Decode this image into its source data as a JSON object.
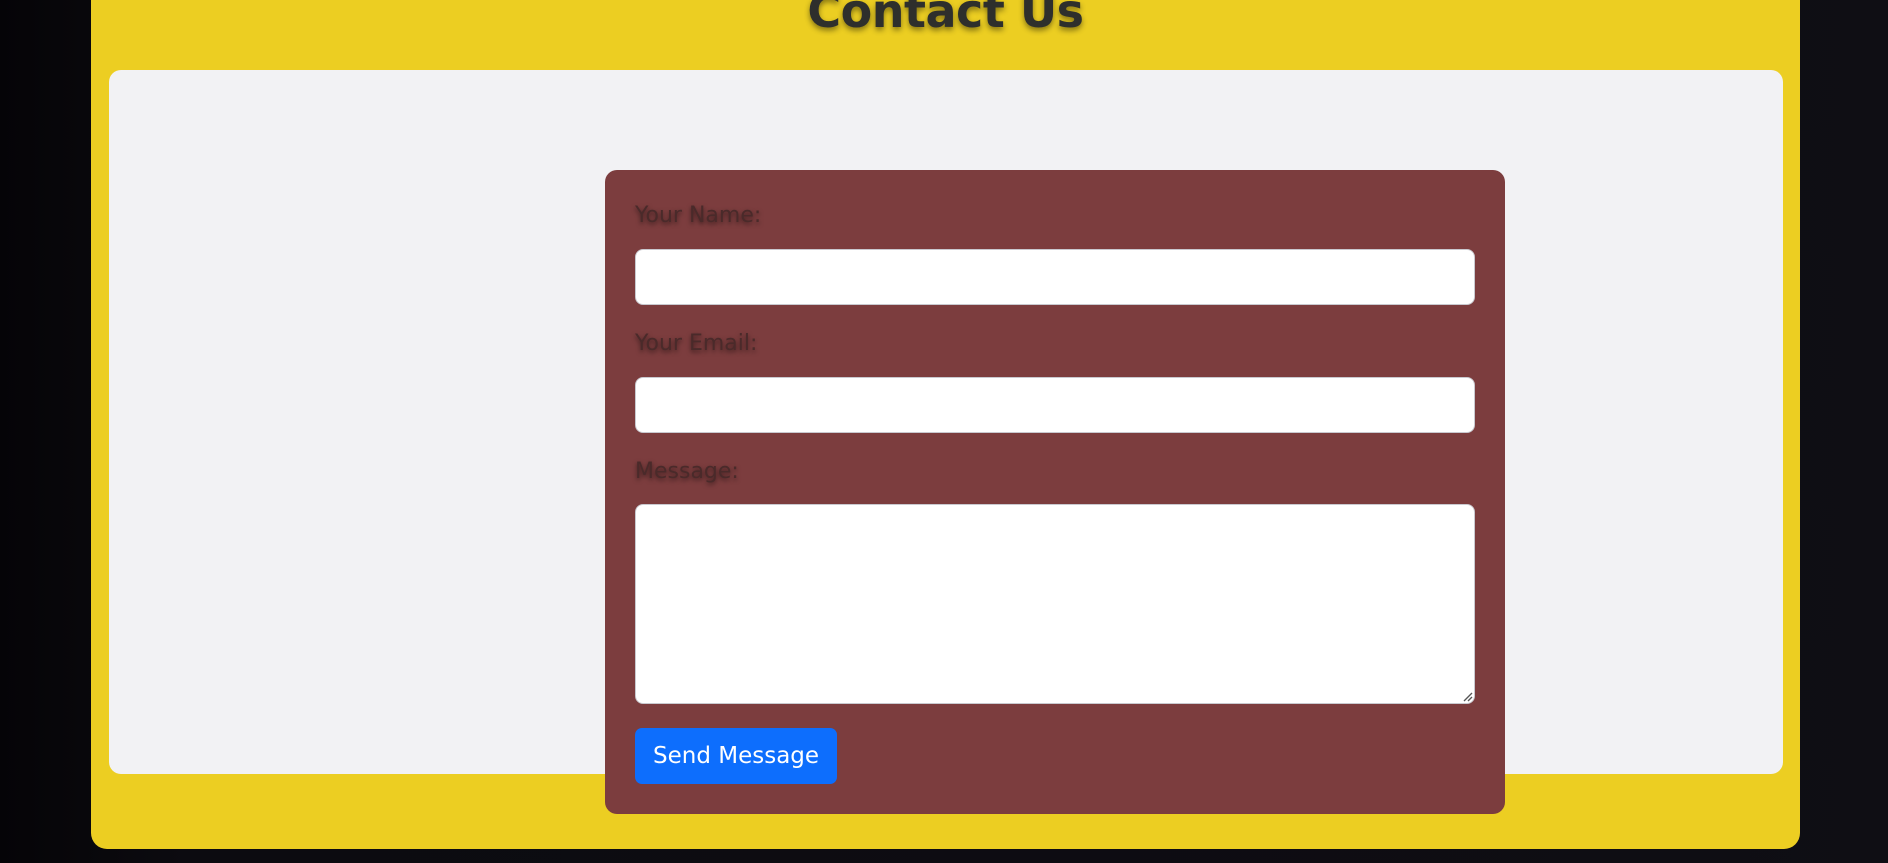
{
  "page": {
    "title": "Contact Us"
  },
  "form": {
    "name_label": "Your Name:",
    "name_value": "",
    "email_label": "Your Email:",
    "email_value": "",
    "message_label": "Message:",
    "message_value": "",
    "submit_label": "Send Message"
  },
  "colors": {
    "outer_background": "#0c0b10",
    "panel_yellow": "#ecce22",
    "card_background": "#f2f2f4",
    "form_background": "#7c3d3e",
    "button_primary": "#0d6efd",
    "label_text": "#4a2a2a",
    "title_text": "#2e2f2c"
  },
  "icons": {
    "textarea_resize": "resize-grip-icon"
  }
}
